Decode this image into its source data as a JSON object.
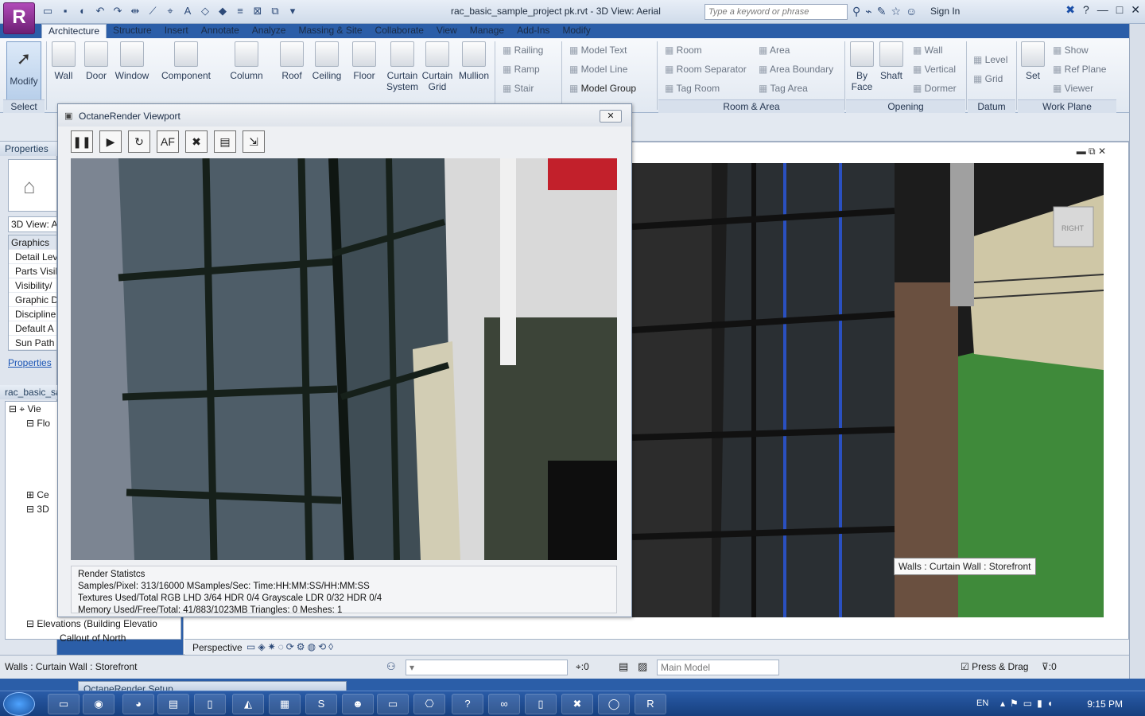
{
  "window": {
    "title": "rac_basic_sample_project pk.rvt - 3D View: Aerial",
    "search_placeholder": "Type a keyword or phrase",
    "signin": "Sign In",
    "app_letter": "R"
  },
  "tabs": [
    "Architecture",
    "Structure",
    "Insert",
    "Annotate",
    "Analyze",
    "Massing & Site",
    "Collaborate",
    "View",
    "Manage",
    "Add-Ins",
    "Modify"
  ],
  "ribbon": {
    "modify": "Modify",
    "select": "Select",
    "build": [
      "Wall",
      "Door",
      "Window",
      "Component",
      "Column",
      "Roof",
      "Ceiling",
      "Floor"
    ],
    "curtain": [
      "Curtain System",
      "Curtain Grid",
      "Mullion"
    ],
    "circulation": [
      "Railing",
      "Ramp",
      "Stair"
    ],
    "model": [
      "Model Text",
      "Model Line",
      "Model Group"
    ],
    "room": [
      "Room",
      "Room Separator",
      "Tag Room",
      "Area",
      "Area Boundary",
      "Tag Area"
    ],
    "room_label": "Room & Area",
    "opening": [
      "By Face",
      "Shaft",
      "Wall",
      "Vertical",
      "Dormer"
    ],
    "opening_label": "Opening",
    "datum": [
      "Level",
      "Grid"
    ],
    "datum_label": "Datum",
    "workplane": [
      "Set",
      "Show",
      "Ref Plane",
      "Viewer"
    ],
    "workplane_label": "Work Plane"
  },
  "properties": {
    "header": "Properties",
    "type": "3D View: A",
    "group": "Graphics",
    "rows": [
      "Detail Lev",
      "Parts Visil",
      "Visibility/",
      "Graphic D",
      "Discipline",
      "Default A",
      "Sun Path"
    ],
    "link": "Properties"
  },
  "browser": {
    "root": "rac_basic_sa",
    "items": [
      "Vie",
      "Flo",
      "Ce",
      "3D",
      "Elevations (Building Elevatio",
      "Callout of North"
    ]
  },
  "octane": {
    "title": "OctaneRender Viewport",
    "tools": [
      "pause-icon",
      "play-icon",
      "restart-icon",
      "af-icon",
      "stop-icon",
      "screen-icon",
      "export-icon"
    ],
    "af_label": "AF",
    "stats_title": "Render Statistcs",
    "stats_line1": "Samples/Pixel:  313/16000   MSamples/Sec:   Time:HH:MM:SS/HH:MM:SS",
    "stats_line2": "Textures Used/Total RGB LHD 3/64  HDR 0/4  Grayscale LDR 0/32  HDR 0/4",
    "stats_line3": "Memory Used/Free/Total: 41/883/1023MB   Triangles: 0   Meshes:  1",
    "setup_title": "OctaneRender Setup"
  },
  "view": {
    "tooltip": "Walls : Curtain Wall : Storefront",
    "scale_label": "Perspective",
    "viewcube_label": "RIGHT"
  },
  "statusbar": {
    "text": "Walls : Curtain Wall : Storefront",
    "filter_count": ":0",
    "model": "Main Model",
    "press_drag": "Press & Drag",
    "selection_count": ":0"
  },
  "taskbar": {
    "lang": "EN",
    "time": "9:15 PM"
  }
}
